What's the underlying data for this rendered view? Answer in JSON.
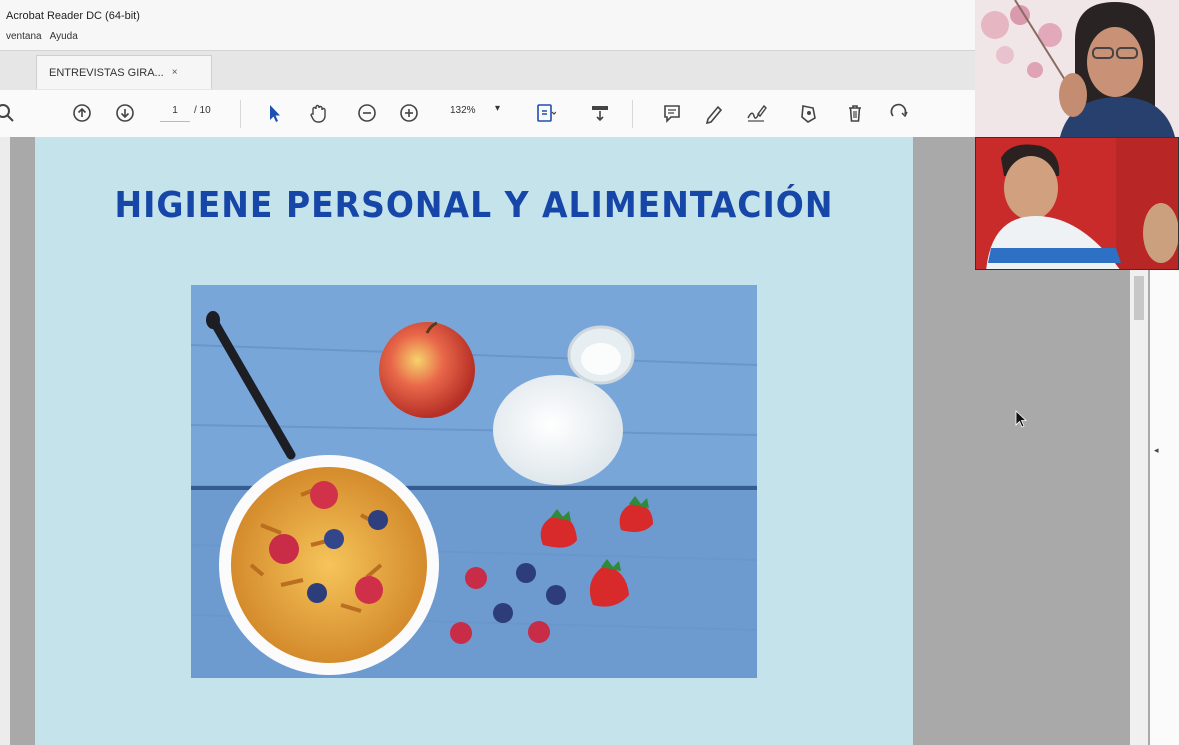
{
  "window": {
    "title": "Acrobat Reader DC (64-bit)",
    "menu": [
      "ventana",
      "Ayuda"
    ]
  },
  "tabs": [
    {
      "label": "ENTREVISTAS GIRA...",
      "close": "×"
    }
  ],
  "toolbar": {
    "page_current": "1",
    "page_total": "/ 10",
    "zoom": "132%",
    "zoom_caret": "▾",
    "icons": [
      "search-icon",
      "page-up-icon",
      "page-down-icon",
      "select-cursor-icon",
      "hand-icon",
      "zoom-out-icon",
      "zoom-in-icon",
      "fit-page-icon",
      "scroll-mode-icon",
      "comment-icon",
      "pen-icon",
      "sign-icon",
      "stamp-icon",
      "delete-icon",
      "rotate-icon"
    ]
  },
  "slide": {
    "title": "HIGIENE PERSONAL Y ALIMENTACIÓN",
    "photo_alt": "cereal bowl, apple, milk bottle, strawberries and berries on blue wooden table"
  },
  "right_rail": {
    "collapse_arrow": "◂"
  },
  "colors": {
    "slide_bg": "#c5e3ea",
    "title_blue": "#1546a8",
    "photo_blue": "#6d9bd0",
    "workspace_gray": "#a9a9a9"
  }
}
